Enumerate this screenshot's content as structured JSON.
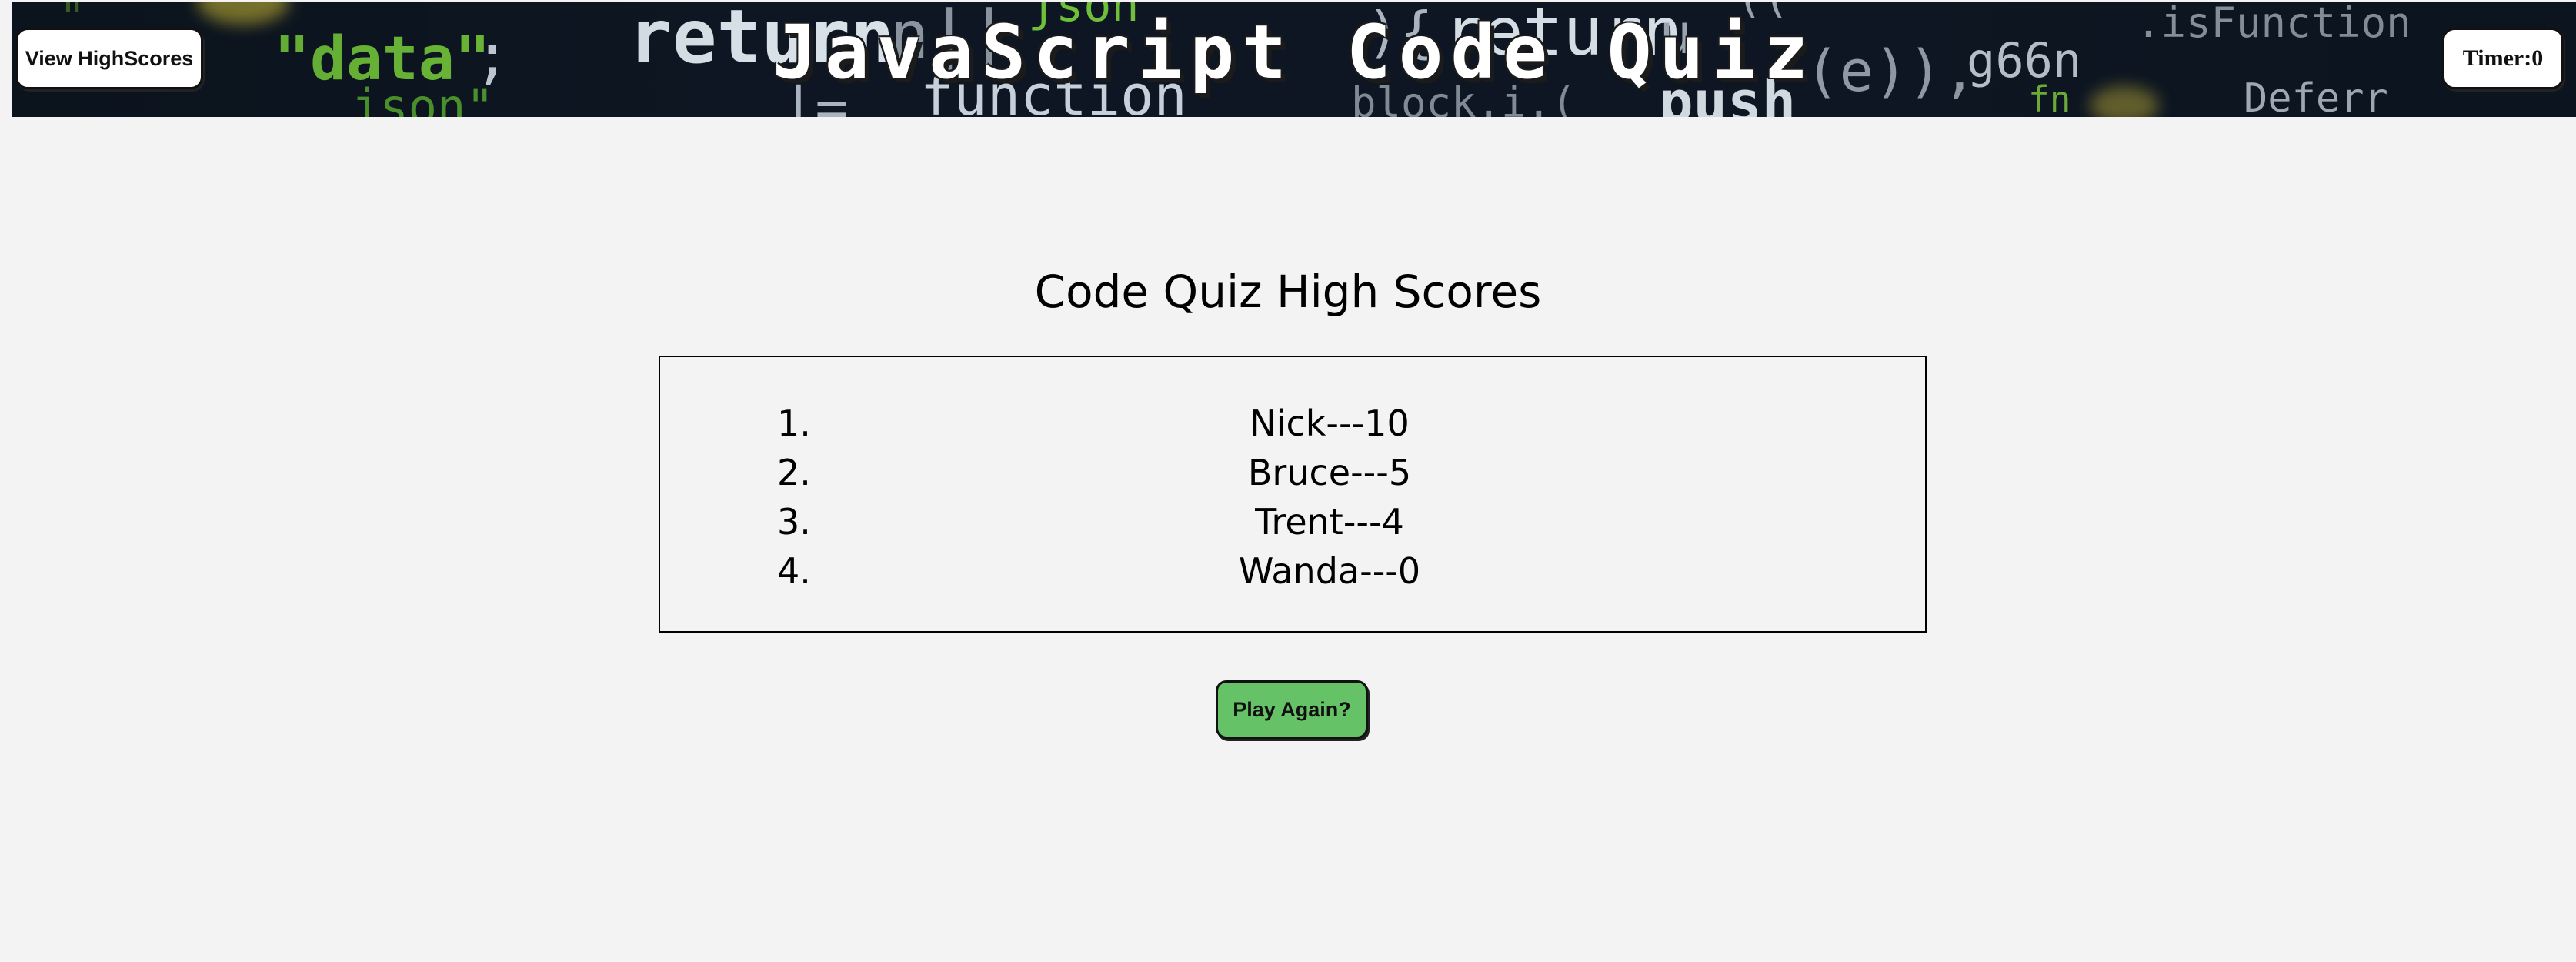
{
  "header": {
    "title": "JavaScript Code Quiz",
    "highscores_button": "View HighScores",
    "timer": "Timer:0"
  },
  "main": {
    "title": "Code Quiz High Scores",
    "scores": [
      {
        "rank": "1.",
        "entry": "Nick---10"
      },
      {
        "rank": "2.",
        "entry": "Bruce---5"
      },
      {
        "rank": "3.",
        "entry": "Trent---4"
      },
      {
        "rank": "4.",
        "entry": "Wanda---0"
      }
    ],
    "play_again_button": "Play Again?"
  },
  "colors": {
    "page_background": "#f3f3f3",
    "play_button": "#66c266",
    "banner_background": "#0d1622"
  }
}
